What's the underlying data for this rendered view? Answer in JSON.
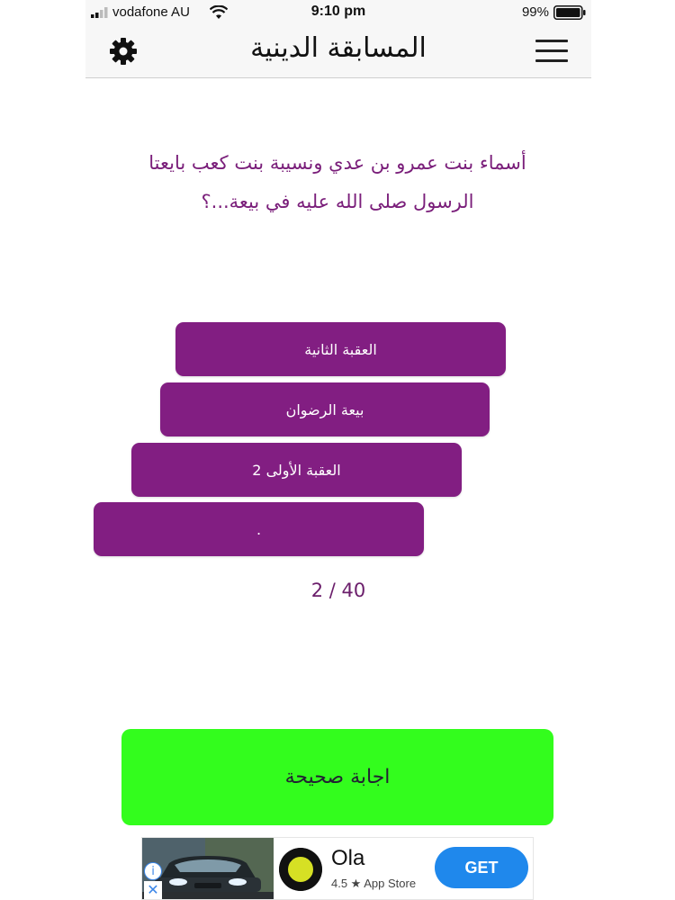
{
  "status_bar": {
    "carrier": "vodafone AU",
    "time": "9:10 pm",
    "battery": "99%"
  },
  "nav": {
    "title": "المسابقة الدينية",
    "settings_icon": "gear-icon",
    "menu_icon": "hamburger-menu-icon"
  },
  "question": {
    "line1": "أسماء بنت عمرو بن عدي ونسيبة بنت كعب بايعتا",
    "line2": "الرسول صلى الله عليه في بيعة...؟"
  },
  "answers": [
    {
      "label": "العقبة الثانية"
    },
    {
      "label": "بيعة الرضوان"
    },
    {
      "label": "العقبة الأولى 2"
    },
    {
      "label": "."
    }
  ],
  "progress": {
    "text": "2 / 40",
    "current": 2,
    "total": 40
  },
  "result": {
    "label": "اجابة صحيحة"
  },
  "ad": {
    "app_name": "Ola",
    "rating": "4.5 ★ App Store",
    "cta": "GET",
    "info_icon": "info-icon",
    "close_icon": "close-icon"
  },
  "colors": {
    "accent": "#821e82",
    "question_text": "#7a1e7a",
    "correct": "#33fd1d",
    "cta_blue": "#1f88ec"
  }
}
